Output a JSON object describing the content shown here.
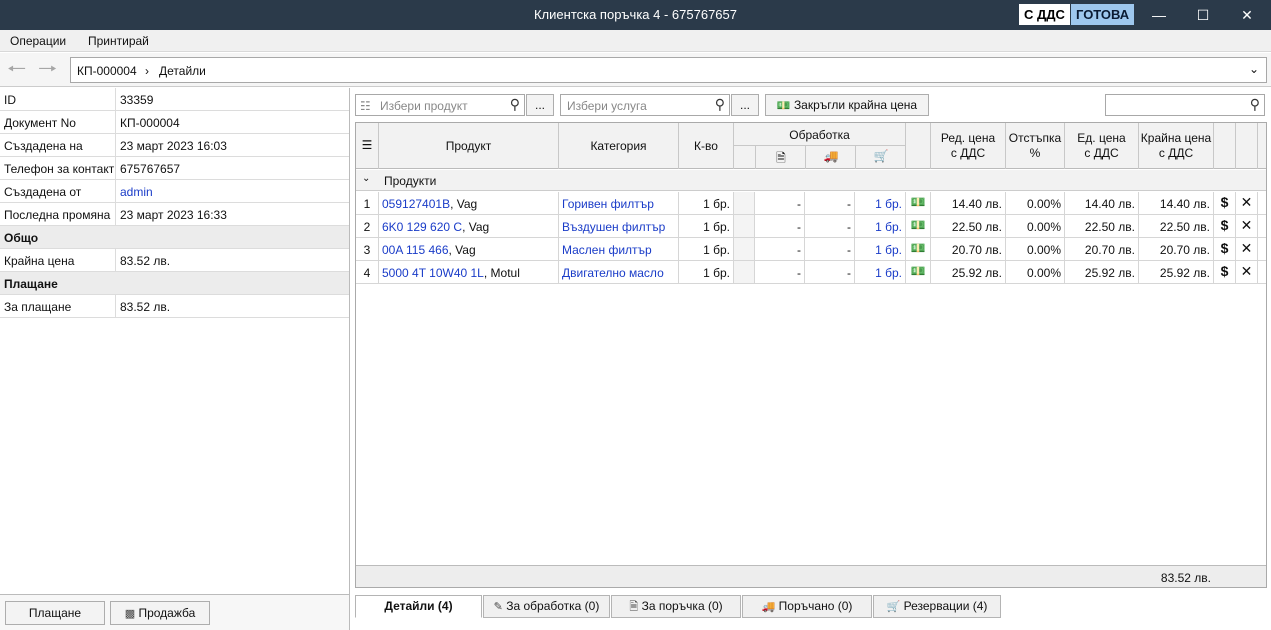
{
  "window": {
    "title": "Клиентска поръчка 4 - 675767657",
    "badge_vat": "С ДДС",
    "badge_status": "ГОТОВА"
  },
  "menu": {
    "operations": "Операции",
    "print": "Принтирай"
  },
  "breadcrumb": {
    "doc": "КП-000004",
    "page": "Детайли"
  },
  "info": [
    {
      "label": "ID",
      "value": "33359"
    },
    {
      "label": "Документ No",
      "value": "КП-000004"
    },
    {
      "label": "Създадена на",
      "value": "23 март 2023 16:03"
    },
    {
      "label": "Телефон за контакт",
      "value": "675767657"
    },
    {
      "label": "Създадена от",
      "value": "admin"
    },
    {
      "label": "Последна промяна",
      "value": "23 март 2023 16:33"
    }
  ],
  "total_section": {
    "title": "Общо",
    "label": "Крайна цена",
    "value": "83.52 лв."
  },
  "payment_section": {
    "title": "Плащане",
    "label": "За плащане",
    "value": "83.52 лв."
  },
  "left_buttons": {
    "pay": "Плащане",
    "sale": "Продажба"
  },
  "toolbar": {
    "product_placeholder": "Избери продукт",
    "service_placeholder": "Избери услуга",
    "ellipsis": "...",
    "round_label": "Закръгли крайна цена"
  },
  "columns": {
    "product": "Продукт",
    "category": "Категория",
    "qty": "К-во",
    "processing": "Обработка",
    "reg_price_1": "Ред. цена",
    "reg_price_2": "с ДДС",
    "discount_1": "Отстъпка",
    "discount_2": "%",
    "unit_price_1": "Ед. цена",
    "unit_price_2": "с ДДС",
    "final_price_1": "Крайна цена",
    "final_price_2": "с ДДС"
  },
  "group": "Продукти",
  "rows": [
    {
      "n": "1",
      "code": "059127401B",
      "brand": ", Vag",
      "category": "Горивен филтър",
      "qty": "1 бр.",
      "p1": "-",
      "p2": "-",
      "p3": "1 бр.",
      "reg": "14.40 лв.",
      "disc": "0.00%",
      "unit": "14.40 лв.",
      "final": "14.40 лв."
    },
    {
      "n": "2",
      "code": "6K0 129 620 C",
      "brand": ", Vag",
      "category": "Въздушен филтър",
      "qty": "1 бр.",
      "p1": "-",
      "p2": "-",
      "p3": "1 бр.",
      "reg": "22.50 лв.",
      "disc": "0.00%",
      "unit": "22.50 лв.",
      "final": "22.50 лв."
    },
    {
      "n": "3",
      "code": "00A 115 466",
      "brand": ", Vag",
      "category": "Маслен филтър",
      "qty": "1 бр.",
      "p1": "-",
      "p2": "-",
      "p3": "1 бр.",
      "reg": "20.70 лв.",
      "disc": "0.00%",
      "unit": "20.70 лв.",
      "final": "20.70 лв."
    },
    {
      "n": "4",
      "code": "5000 4T 10W40 1L",
      "brand": ", Motul",
      "category": "Двигателно масло",
      "qty": "1 бр.",
      "p1": "-",
      "p2": "-",
      "p3": "1 бр.",
      "reg": "25.92 лв.",
      "disc": "0.00%",
      "unit": "25.92 лв.",
      "final": "25.92 лв."
    }
  ],
  "footer_total": "83.52 лв.",
  "tabs": [
    "Детайли (4)",
    "За обработка (0)",
    "За поръчка (0)",
    "Поръчано (0)",
    "Резервации (4)"
  ]
}
